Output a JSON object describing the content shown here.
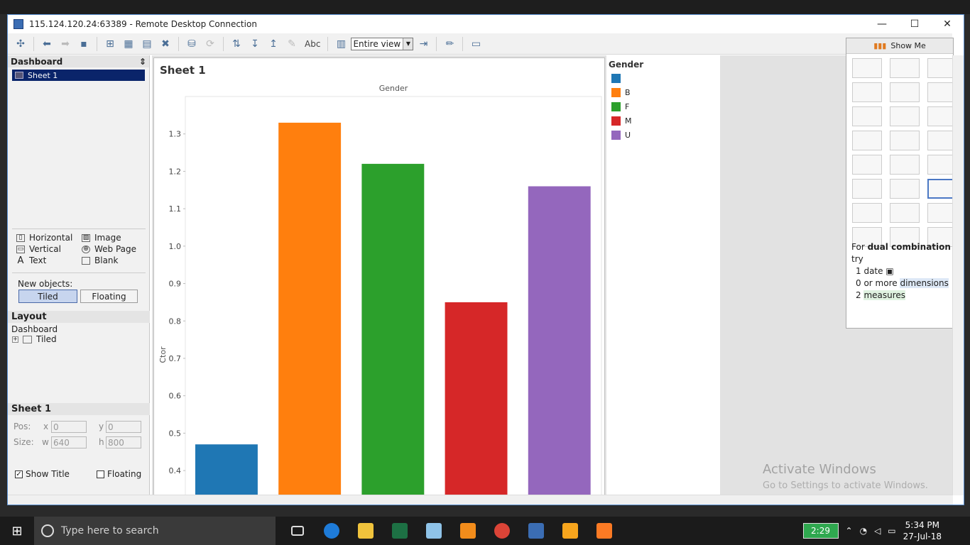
{
  "window": {
    "title": "115.124.120.24:63389 - Remote Desktop Connection",
    "min_glyph": "—",
    "max_glyph": "☐",
    "close_glyph": "✕"
  },
  "toolbar": {
    "view_select": "Entire view",
    "abc_label": "Abc"
  },
  "left_pane": {
    "dashboard_header": "Dashboard",
    "sheet_item": "Sheet 1",
    "objects": [
      {
        "label": "Horizontal",
        "icon": "horizontal-icon"
      },
      {
        "label": "Image",
        "icon": "image-icon"
      },
      {
        "label": "Vertical",
        "icon": "vertical-icon"
      },
      {
        "label": "Web Page",
        "icon": "globe-icon"
      },
      {
        "label": "Text",
        "icon": "text-icon"
      },
      {
        "label": "Blank",
        "icon": "blank-icon"
      }
    ],
    "new_objects_label": "New objects:",
    "tiled_label": "Tiled",
    "floating_label": "Floating",
    "layout_header": "Layout",
    "layout_dashboard": "Dashboard",
    "layout_tiled": "Tiled",
    "sheet_header": "Sheet 1",
    "pos_label": "Pos:",
    "x_label": "x",
    "y_label": "y",
    "x_value": "0",
    "y_value": "0",
    "size_label": "Size:",
    "w_label": "w",
    "h_label": "h",
    "w_value": "640",
    "h_value": "800",
    "show_title_label": "Show Title",
    "show_title_checked": true,
    "floating_check_label": "Floating",
    "floating_checked": false
  },
  "sheet": {
    "title": "Sheet 1"
  },
  "chart_data": {
    "type": "bar",
    "title": "Gender",
    "xlabel": "",
    "ylabel": "Ctor",
    "categories": [
      "",
      "B",
      "F",
      "M",
      "U"
    ],
    "values": [
      0.47,
      1.33,
      1.22,
      0.85,
      1.16
    ],
    "colors": [
      "#1f77b4",
      "#ff7f0e",
      "#2ca02c",
      "#d62728",
      "#9467bd"
    ],
    "yticks": [
      "1.3",
      "1.2",
      "1.1",
      "1.0",
      "0.9",
      "0.8",
      "0.7",
      "0.6",
      "0.5",
      "0.4"
    ],
    "ylim": [
      0.33,
      1.4
    ],
    "grid": false
  },
  "legend": {
    "title": "Gender",
    "items": [
      {
        "label": "",
        "color": "#1f77b4"
      },
      {
        "label": "B",
        "color": "#ff7f0e"
      },
      {
        "label": "F",
        "color": "#2ca02c"
      },
      {
        "label": "M",
        "color": "#d62728"
      },
      {
        "label": "U",
        "color": "#9467bd"
      }
    ]
  },
  "show_me": {
    "header": "Show Me",
    "hint_prefix": "For",
    "hint_bold": "dual combination",
    "hint_suffix": "try",
    "req_date": "1 date",
    "req_dims_prefix": "0 or more",
    "req_dims": "dimensions",
    "req_measures_prefix": "2",
    "req_measures": "measures"
  },
  "watermark": {
    "line1": "Activate Windows",
    "line2": "Go to Settings to activate Windows."
  },
  "taskbar": {
    "search_placeholder": "Type here to search",
    "battery": "2:29",
    "time": "5:34 PM",
    "date": "27-Jul-18"
  }
}
